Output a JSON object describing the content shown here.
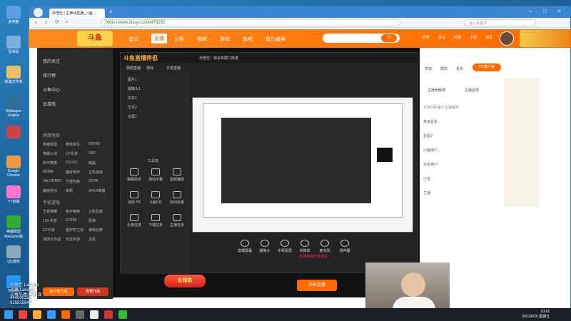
{
  "desktop": {
    "icons": [
      "此电脑",
      "回收站",
      "新建文件夹",
      "Wallpaper Engine",
      "",
      "Google Chrome",
      "YY直播",
      "英雄联盟 WeGame版",
      "QQ游戏",
      "ToDesk"
    ]
  },
  "browser": {
    "tab_title": "孙悟空 | 主神仙直播_斗鱼...",
    "url": "https://www.douyu.com/475252",
    "bookmarks": [
      "收藏",
      "MQ - 孙悟空",
      "第三·虎网",
      "斗鱼",
      "3L 搜狗浏览",
      "lol赛王者",
      "斗鱼·…",
      "单排神枪",
      "发现·我们",
      "淘宝网",
      "沙心站",
      "知乎世",
      "每年增多20"
    ],
    "search_placeholder": "输入关键字"
  },
  "douyu": {
    "nav": [
      "首页",
      "直播",
      "分类",
      "视频",
      "游戏",
      "鱼吧",
      "鱼乐盛典"
    ],
    "active_nav": "直播",
    "header_icons": [
      "历史",
      "关注",
      "开播",
      "下载",
      "消息"
    ],
    "sidebar": {
      "items": [
        "我的关注",
        "排行榜",
        "斗鱼中心",
        "云游戏"
      ],
      "game_section": "网游竞技",
      "games": [
        "英雄联盟",
        "绝地求生",
        "DOTA2",
        "穿越火线",
        "CF手游",
        "DNF",
        "和平精英",
        "CS:GO",
        "暗黑",
        "MOBA",
        "魔兽世界",
        "主机游戏",
        "VALORANT",
        "守望先锋",
        "DOTA",
        "魔兽怀旧",
        "街机",
        "APEX英雄"
      ],
      "mobile_section": "手机游戏",
      "mobile_games": [
        "王者荣耀",
        "和平精英",
        "火影忍者",
        "LOL手游",
        "CODM",
        "原神",
        "CF手游",
        "金铲铲之战",
        "使命召唤",
        "球球大作战",
        "天龙手游",
        "主机"
      ],
      "btn_a": "客户端下载",
      "btn_b": "我要开播"
    },
    "streamer_title": "孙悟空：峡谷有群口技者",
    "right_panel": {
      "tabs": [
        "举报",
        "帮助",
        "更多"
      ],
      "pc_btn": "PC客户端",
      "rank_tabs": [
        "主播贡献榜",
        "主播星榜"
      ],
      "notice": "本房间由鱼乐主播提供",
      "chat": [
        "幸运星星",
        "星星3",
        "小鱼用户",
        "大宗用户",
        "小宝",
        "主播"
      ]
    }
  },
  "douyu_studio": {
    "logo": "斗鱼直播伴侣",
    "tabs": [
      "网络直播",
      "游戏",
      "手游直播"
    ],
    "layers": [
      "图片1",
      "摄像头1",
      "文本1",
      "文本2",
      "全屏1"
    ],
    "tools": [
      "弹幕助手",
      "滚动字幕",
      "视频播放",
      "全民 PK",
      "斗鱼GIF",
      "房间设置",
      "礼物任务",
      "下载任务",
      "主播任务"
    ],
    "tool_header": "工具箱",
    "controls": [
      "直播屏幕",
      "摄像头",
      "手机投屏",
      "多媒体",
      "麦克风",
      "扬声器"
    ],
    "start_btn": "开始直播",
    "promo": "去领取",
    "status_bar": "直播网络质量良好"
  },
  "overlay": {
    "lines": [
      "孙悟空 Lakings",
      "斗鱼 Lakings",
      "斗鱼牛虎 ❤ 翻译",
      "444000254",
      "815815847"
    ]
  },
  "taskbar": {
    "time": "10:16",
    "date": "2021/6/25 星期五"
  }
}
